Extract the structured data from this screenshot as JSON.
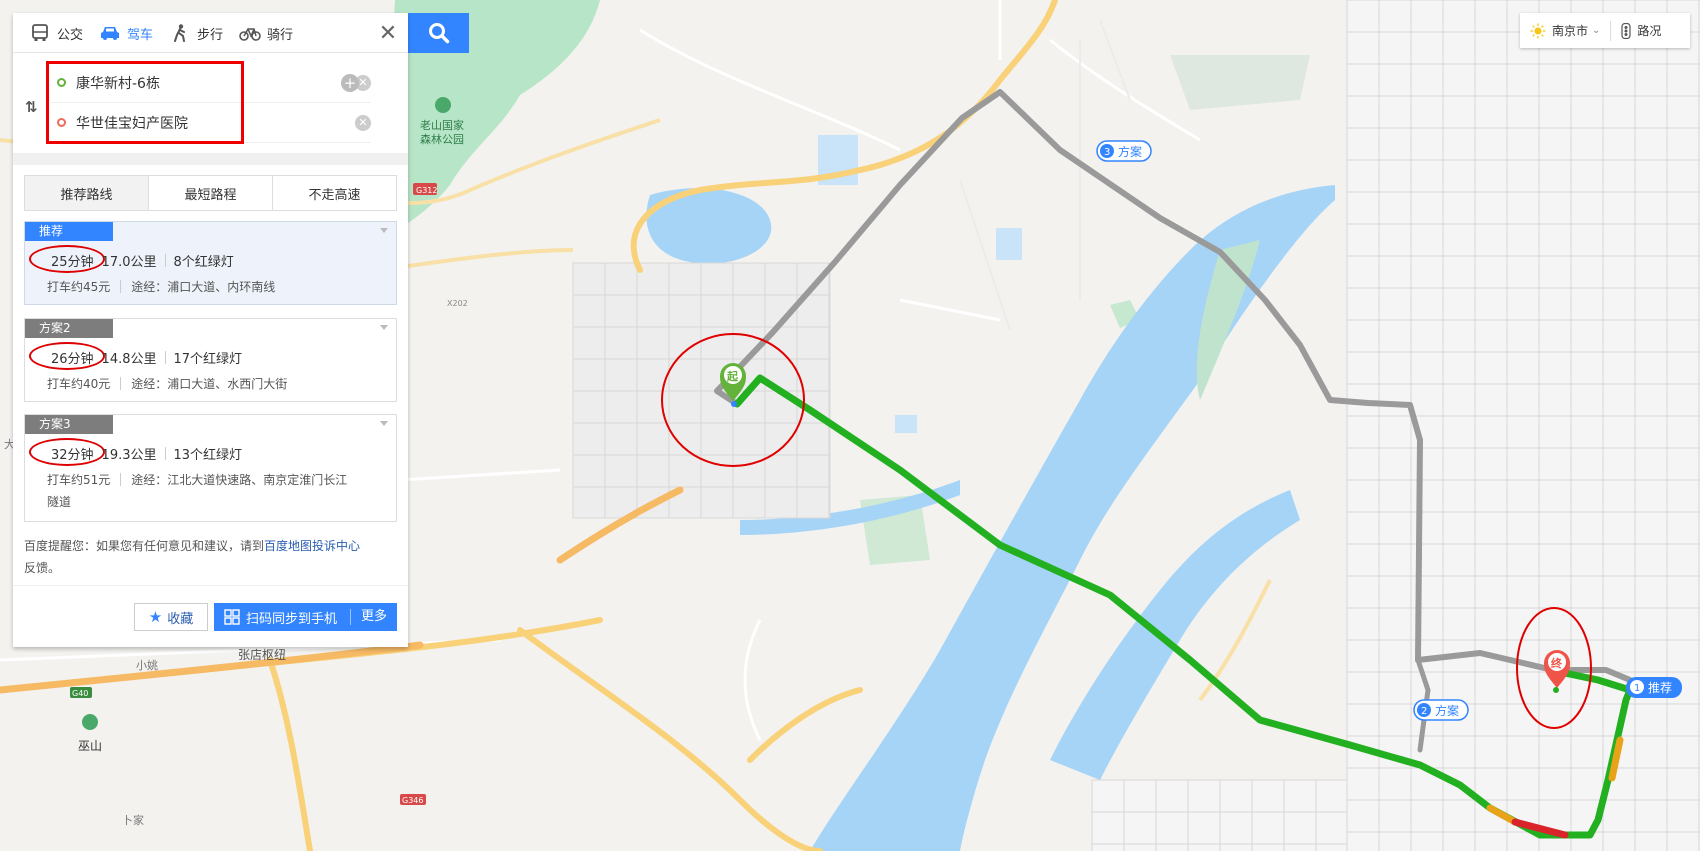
{
  "modes": [
    {
      "label": "公交",
      "icon": "bus-icon",
      "active": false
    },
    {
      "label": "驾车",
      "icon": "car-icon",
      "active": true
    },
    {
      "label": "步行",
      "icon": "walk-icon",
      "active": false
    },
    {
      "label": "骑行",
      "icon": "bike-icon",
      "active": false
    }
  ],
  "route": {
    "start": "康华新村-6栋",
    "end": "华世佳宝妇产医院"
  },
  "tabs": [
    "推荐路线",
    "最短路程",
    "不走高速"
  ],
  "plans": [
    {
      "tag": "推荐",
      "time": "25分钟",
      "distance": "17.0公里",
      "lights": "8个红绿灯",
      "taxi": "打车约45元",
      "via_prefix": "途经：",
      "via": "浦口大道、内环南线"
    },
    {
      "tag": "方案2",
      "time": "26分钟",
      "distance": "14.8公里",
      "lights": "17个红绿灯",
      "taxi": "打车约40元",
      "via_prefix": "途经：",
      "via": "浦口大道、水西门大街"
    },
    {
      "tag": "方案3",
      "time": "32分钟",
      "distance": "19.3公里",
      "lights": "13个红绿灯",
      "taxi": "打车约51元",
      "via_prefix": "途经：",
      "via": "江北大道快速路、南京定淮门长江",
      "via2": "隧道"
    }
  ],
  "notice": {
    "text": "百度提醒您：如果您有任何意见和建议，请到",
    "link": "百度地图投诉中心",
    "tail": "反馈。"
  },
  "actions": {
    "favorite": "收藏",
    "sync": "扫码同步到手机",
    "more": "更多"
  },
  "top_right": {
    "city": "南京市",
    "traffic": "路况"
  },
  "map": {
    "labels": {
      "forest": "老山国家\n森林公园",
      "forest_l1": "老山国家",
      "forest_l2": "森林公园",
      "g312": "G312",
      "x202": "X202",
      "g40": "G40",
      "g346": "G346",
      "xiaoyao": "小姚",
      "zhangdian": "张店枢纽",
      "wushan": "巫山",
      "bujia": "卜家",
      "da": "大"
    },
    "markers": {
      "start": "起",
      "end": "终",
      "plan3": "方案",
      "plan3_num": "3",
      "plan2": "方案",
      "plan2_num": "2",
      "plan1": "推荐",
      "plan1_num": "1"
    },
    "colors": {
      "route_main": "#22b021",
      "route_alt": "#9a9a9a",
      "water": "#a6d4f7",
      "park": "#b5e4c6",
      "road_major": "#f7cd68",
      "annotation": "#e00000"
    }
  }
}
